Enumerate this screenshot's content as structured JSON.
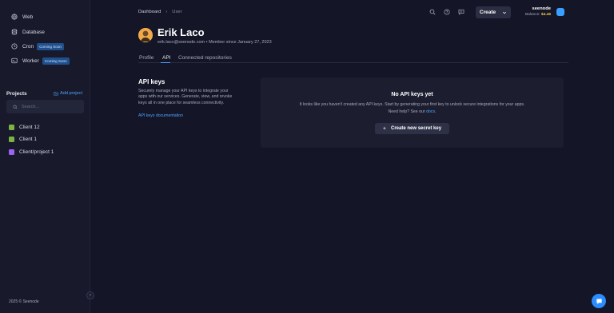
{
  "sidebar": {
    "nav": [
      {
        "label": "Web",
        "icon": "globe-icon"
      },
      {
        "label": "Database",
        "icon": "database-icon"
      },
      {
        "label": "Cron",
        "icon": "clock-icon",
        "badge": "Coming Soon"
      },
      {
        "label": "Worker",
        "icon": "terminal-icon",
        "badge": "Coming Soon"
      }
    ],
    "projects_title": "Projects",
    "add_project_label": "Add project",
    "search_placeholder": "Search...",
    "projects": [
      {
        "label": "Client 12",
        "color": "#8bc34a"
      },
      {
        "label": "Client 1",
        "color": "#8bc34a"
      },
      {
        "label": "Client/project 1",
        "color": "#a46bff"
      }
    ],
    "copyright": "2025 © Seenode"
  },
  "header": {
    "breadcrumb": [
      "Dashboard",
      "User"
    ],
    "create_label": "Create",
    "account_name": "seenode",
    "balance_label": "Balance:",
    "balance_value": "$4.46"
  },
  "user": {
    "name": "Erik Laco",
    "meta": "erik.laco@seenode.com • Member since January 27, 2023"
  },
  "tabs": [
    "Profile",
    "API",
    "Connected repositories"
  ],
  "active_tab": "API",
  "api_section": {
    "title": "API keys",
    "description": "Securely manage your API keys to integrate your apps with our services. Generate, view, and revoke keys all in one place for seamless connectivity.",
    "docs_link": "API keys documentation"
  },
  "empty_state": {
    "title": "No API keys yet",
    "line1": "It looks like you haven't created any API keys. Start by generating your first key to unlock secure integrations for your apps.",
    "line2_prefix": "Need help? See our",
    "line2_link": "docs",
    "line2_suffix": ".",
    "button_label": "Create new secret key"
  },
  "colors": {
    "accent": "#4da3ff",
    "badge": "#1f4f8c",
    "balance": "#f2c94c",
    "chat": "#2b8cff"
  }
}
